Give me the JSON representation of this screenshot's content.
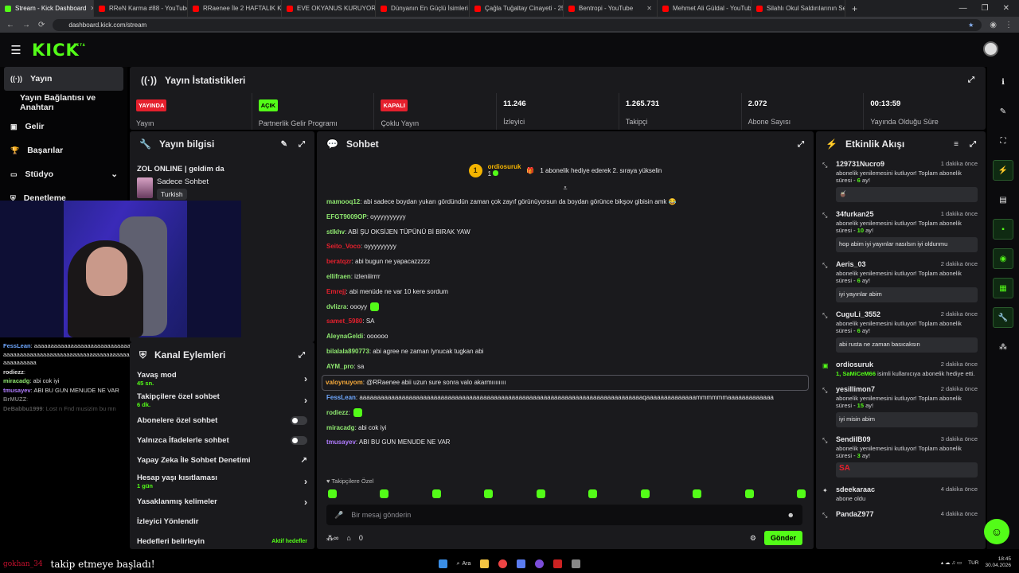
{
  "browser": {
    "tabs": [
      {
        "label": "Stream - Kick Dashboard",
        "color": "#53fc18",
        "active": true
      },
      {
        "label": "RReN Karma #88 - YouTube",
        "color": "#ff0000"
      },
      {
        "label": "RRaenee İle 2 HAFTALIK KOMİK",
        "color": "#ff0000"
      },
      {
        "label": "EVE OKYANUS KURUYORUZ BÜ",
        "color": "#ff0000"
      },
      {
        "label": "Dünyanın En Güçlü İsimleri Bu",
        "color": "#ff0000"
      },
      {
        "label": "Çağla Tuğaltay Cinayeti - 25 Yıl",
        "color": "#ff0000"
      },
      {
        "label": "Bentropi - YouTube",
        "color": "#ff0000"
      },
      {
        "label": "Mehmet Ali Güldal - YouTube",
        "color": "#ff0000"
      },
      {
        "label": "Silahlı Okul Saldırılarının Sebebi",
        "color": "#ff0000"
      }
    ],
    "url": "dashboard.kick.com/stream"
  },
  "brand": {
    "logo": "KICK",
    "beta": "BETA",
    "accent": "#53fc18"
  },
  "sidenav": [
    {
      "label": "Yayın",
      "icon": "broadcast-icon"
    },
    {
      "label": "Yayın Bağlantısı ve Anahtarı",
      "icon": ""
    },
    {
      "label": "Gelir",
      "icon": "revenue-icon"
    },
    {
      "label": "Başarılar",
      "icon": "trophy-icon"
    },
    {
      "label": "Stüdyo",
      "icon": "studio-icon"
    },
    {
      "label": "Denetleme",
      "icon": "moderation-icon"
    }
  ],
  "stats": {
    "title": "Yayın İstatistikleri",
    "cells": [
      {
        "badge": "YAYINDA",
        "badge_color": "#e5202d",
        "label": "Yayın"
      },
      {
        "badge": "AÇIK",
        "badge_color": "#53fc18",
        "label": "Partnerlik Gelir Programı"
      },
      {
        "badge": "KAPALI",
        "badge_color": "#e5202d",
        "label": "Çoklu Yayın"
      },
      {
        "value": "11.246",
        "label": "İzleyici"
      },
      {
        "value": "1.265.731",
        "label": "Takipçi"
      },
      {
        "value": "2.072",
        "label": "Abone Sayısı"
      },
      {
        "value": "00:13:59",
        "label": "Yayında Olduğu Süre"
      }
    ]
  },
  "info": {
    "title": "Yayın bilgisi",
    "stream_title": "ZOL ONLINE | geldim da",
    "category": "Sadece Sohbet",
    "tag": "Turkish"
  },
  "settings": {
    "title": "Kanal Eylemleri",
    "rows": [
      {
        "label": "Yavaş mod",
        "sub": "45 sn."
      },
      {
        "label": "Takipçilere özel sohbet",
        "sub": "6 dk."
      },
      {
        "label": "Abonelere özel sohbet",
        "sub": ""
      },
      {
        "label": "Yalnızca İfadelerle sohbet",
        "sub": ""
      },
      {
        "label": "Yapay Zeka İle Sohbet Denetimi",
        "sub": ""
      },
      {
        "label": "Hesap yaşı kısıtlaması",
        "sub": "1 gün"
      },
      {
        "label": "Yasaklanmış kelimeler",
        "sub": ""
      },
      {
        "label": "İzleyici Yönlendir",
        "sub": ""
      },
      {
        "label": "Hedefleri belirleyin",
        "sub": ""
      }
    ],
    "extra_label": "Aktif hedefler"
  },
  "chat": {
    "title": "Sohbet",
    "pinned": {
      "rank": "1",
      "user": "ordiosuruk",
      "count": "1",
      "text": "1 abonelik hediye ederek 2. sıraya yükselin"
    },
    "messages": [
      {
        "user": "mamooq12",
        "color": "#8fe870",
        "text": ": abi sadece boydan yukarı gördündün zaman çok zayıf görünüyorsun da boydan görünce bikşov gibisin amk 😂"
      },
      {
        "user": "EFGT9009OP",
        "color": "#8fe870",
        "text": ": oyyyyyyyyyy"
      },
      {
        "user": "stlkhv",
        "color": "#8fe870",
        "text": ": ABİ ŞU OKSİJEN TÜPÜNÜ Bİ BIRAK YAW"
      },
      {
        "user": "Seito_Voco",
        "color": "#e5202d",
        "text": ": oyyyyyyyyy"
      },
      {
        "user": "beratqzr",
        "color": "#e5202d",
        "text": ": abi bugun ne yapacazzzzz"
      },
      {
        "user": "ellifraen",
        "color": "#8fe870",
        "text": ": izleniiirrrr"
      },
      {
        "user": "Emrejj",
        "color": "#e5202d",
        "text": ": abi menüde ne var 10 kere sordum"
      },
      {
        "user": "dvlizra",
        "color": "#8fe870",
        "text": ": oooyy"
      },
      {
        "user": "samet_5980",
        "color": "#e5202d",
        "text": ": SA"
      },
      {
        "user": "AleynaGeldi",
        "color": "#8fe870",
        "text": ": oooooo"
      },
      {
        "user": "bilalala890773",
        "color": "#8fe870",
        "text": ": abi agree ne zaman lynucak tugkan abi"
      },
      {
        "user": "AYM_pro",
        "color": "#8fe870",
        "text": ": sa"
      },
      {
        "user": "valoynuyom",
        "color": "#f4a83a",
        "text": ": @RRaenee abii uzun sure sonra valo akarmıııııııı",
        "highlight": true
      },
      {
        "user": "FessLean",
        "color": "#6fa8ff",
        "text": ": aaaaaaaaaaaaaaaaaaaaaaaaaaaaaaaaaaaaaaaaaaaaaaaaaaaaaaaaaaaaaaaaaaaaaaaaaaaaaaaaqaaaaaaaaaaaaaammmmmmaaaaaaaaaaaaa"
      },
      {
        "user": "rodiezz",
        "color": "#8fe870",
        "text": ":"
      },
      {
        "user": "miracadg",
        "color": "#8fe870",
        "text": ": abi cok iyi"
      },
      {
        "user": "tmusayev",
        "color": "#b07cff",
        "text": ": ABI BU GUN MENUDE NE VAR"
      }
    ],
    "followers_only": "Takipçilere Özel",
    "placeholder": "Bir mesaj gönderin",
    "points": "0",
    "send": "Gönder"
  },
  "feed": {
    "title": "Etkinlik Akışı",
    "events": [
      {
        "user": "129731Nucro9",
        "time": "1 dakika önce",
        "desc": "abonelik yenilemesini kutluyor! Toplam abonelik süresi - ",
        "months": "6",
        "unit": " ay!",
        "box": "🧉"
      },
      {
        "user": "34furkan25",
        "time": "1 dakika önce",
        "desc": "abonelik yenilemesini kutluyor! Toplam abonelik süresi - ",
        "months": "10",
        "unit": " ay!",
        "box": "hop abim iyi yayınlar nasılsın iyi oldunmu"
      },
      {
        "user": "Aeris_03",
        "time": "2 dakika önce",
        "desc": "abonelik yenilemesini kutluyor! Toplam abonelik süresi - ",
        "months": "6",
        "unit": " ay!",
        "box": "iyi yayınlar abim"
      },
      {
        "user": "CuguLi_3552",
        "time": "2 dakika önce",
        "desc": "abonelik yenilemesini kutluyor! Toplam abonelik süresi - ",
        "months": "6",
        "unit": " ay!",
        "box": "abi rusta ne zaman basıcaksın"
      },
      {
        "user": "ordiosuruk",
        "time": "2 dakika önce",
        "desc": "",
        "months": "1, SaMiCeM66",
        "unit": " isimli kullanıcıya abonelik hediye etti.",
        "box": ""
      },
      {
        "user": "yesillimon7",
        "time": "2 dakika önce",
        "desc": "abonelik yenilemesini kutluyor! Toplam abonelik süresi - ",
        "months": "15",
        "unit": " ay!",
        "box": "iyi misin abim"
      },
      {
        "user": "SendilB09",
        "time": "3 dakika önce",
        "desc": "abonelik yenilemesini kutluyor! Toplam abonelik süresi - ",
        "months": "3",
        "unit": " ay!",
        "box": "SA"
      },
      {
        "user": "sdeekaraac",
        "time": "4 dakika önce",
        "desc": "abone oldu",
        "months": "",
        "unit": "",
        "box": ""
      },
      {
        "user": "PandaZ977",
        "time": "4 dakika önce",
        "desc": "",
        "months": "",
        "unit": "",
        "box": ""
      }
    ]
  },
  "overlay_chat": [
    {
      "user": "FessLean",
      "color": "#6fa8ff",
      "text": ": aaaaaaaaaaaaaaaaaaaaaaaaaaaaaaaaaaaaaaaaaaaaaaaaaaaaaaaaaaaaaaaaaaaaaaaaaaaaaaaaaaaaaaaaaaaaaaaaaaaaaaaaaaaaaaaaaaaaaaaaaaaammaaaaaaaaaaaaa"
    },
    {
      "user": "rodiezz",
      "color": "#ddd",
      "text": ":"
    },
    {
      "user": "miracadg",
      "color": "#8fe870",
      "text": ": abi cok iyi"
    },
    {
      "user": "tmusayev",
      "color": "#b07cff",
      "text": ": ABI BU GUN MENUDE NE VAR"
    },
    {
      "user": "BrMUZZ",
      "color": "#777",
      "text": ":"
    },
    {
      "user": "DeBabbu1999",
      "color": "#555",
      "text": ": Lost n Fnd musizim bu mn"
    }
  ],
  "follow_overlay": {
    "name": "gokhan_34",
    "text": "takip etmeye başladı!"
  },
  "tray": {
    "lang": "TUR",
    "time": "18:45",
    "date": "30.04.2026"
  },
  "taskbar": {
    "search": "Ara"
  }
}
